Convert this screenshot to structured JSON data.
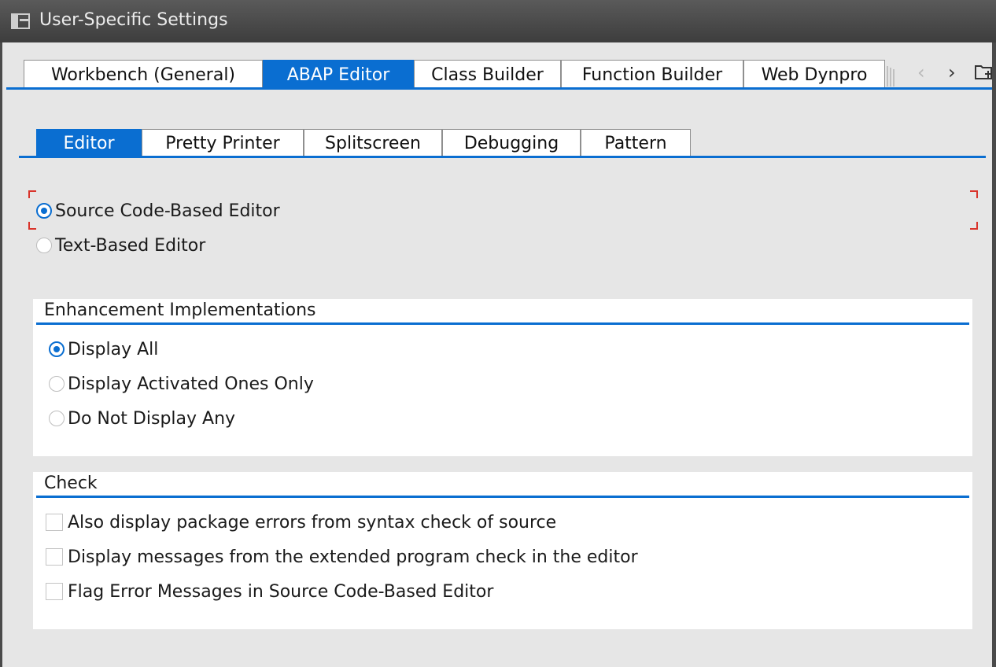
{
  "window": {
    "title": "User-Specific Settings"
  },
  "main_tabs": [
    {
      "label": "Workbench (General)",
      "active": false
    },
    {
      "label": "ABAP Editor",
      "active": true
    },
    {
      "label": "Class Builder",
      "active": false
    },
    {
      "label": "Function Builder",
      "active": false
    },
    {
      "label": "Web Dynpro",
      "active": false
    }
  ],
  "tab_nav": {
    "prev_icon": "chevron-left-icon",
    "next_icon": "chevron-right-icon",
    "menu_icon": "folder-list-icon"
  },
  "sub_tabs": [
    {
      "label": "Editor",
      "active": true
    },
    {
      "label": "Pretty Printer",
      "active": false
    },
    {
      "label": "Splitscreen",
      "active": false
    },
    {
      "label": "Debugging",
      "active": false
    },
    {
      "label": "Pattern",
      "active": false
    }
  ],
  "editor_mode": {
    "options": [
      {
        "label": "Source Code-Based Editor",
        "selected": true
      },
      {
        "label": "Text-Based Editor",
        "selected": false
      }
    ]
  },
  "enhancements": {
    "title": "Enhancement Implementations",
    "options": [
      {
        "label": "Display All",
        "selected": true
      },
      {
        "label": "Display Activated Ones Only",
        "selected": false
      },
      {
        "label": "Do Not Display Any",
        "selected": false
      }
    ]
  },
  "check": {
    "title": "Check",
    "options": [
      {
        "label": "Also display package errors from syntax check of source",
        "checked": false
      },
      {
        "label": "Display messages from the extended program check in the editor",
        "checked": false
      },
      {
        "label": "Flag Error Messages in Source Code-Based Editor",
        "checked": false
      }
    ]
  },
  "colors": {
    "accent": "#0a6ed1",
    "titlebar": "#3d3d3d",
    "background": "#e6e6e6",
    "focus": "#d9342b"
  }
}
